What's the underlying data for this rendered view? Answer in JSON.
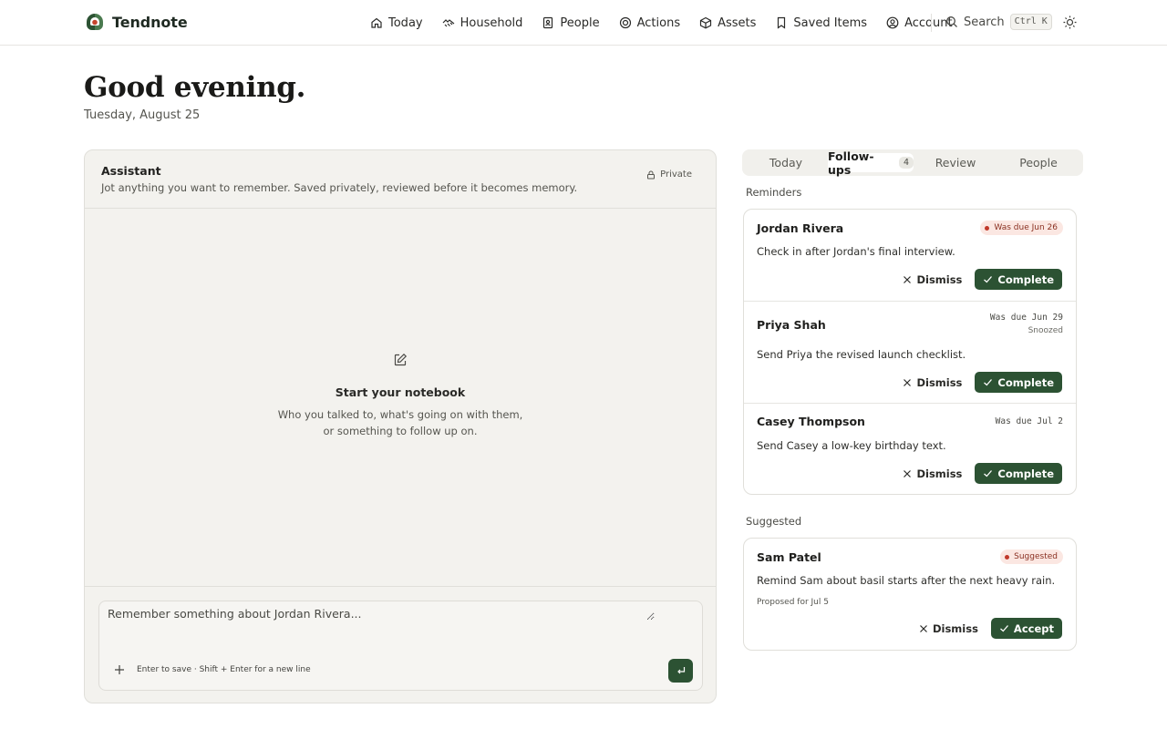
{
  "app": {
    "name": "Tendnote"
  },
  "nav": {
    "items": [
      {
        "label": "Today",
        "icon": "home-icon"
      },
      {
        "label": "Household",
        "icon": "household-icon"
      },
      {
        "label": "People",
        "icon": "contacts-book-icon"
      },
      {
        "label": "Actions",
        "icon": "target-icon"
      },
      {
        "label": "Assets",
        "icon": "box-icon"
      },
      {
        "label": "Saved Items",
        "icon": "bookmark-icon"
      },
      {
        "label": "Account",
        "icon": "user-circle-icon"
      }
    ],
    "search_label": "Search",
    "search_shortcut": "Ctrl K"
  },
  "greeting": {
    "title": "Good evening.",
    "date": "Tuesday, August 25"
  },
  "assistant": {
    "title": "Assistant",
    "subtitle": "Jot anything you want to remember. Saved privately, reviewed before it becomes memory.",
    "privacy": "Private",
    "empty_title": "Start your notebook",
    "empty_desc": "Who you talked to, what's going on with them, or something to follow up on.",
    "placeholder": "Remember something about Jordan Rivera...",
    "hint": "Enter to save · Shift + Enter for a new line"
  },
  "tabs": [
    {
      "label": "Today"
    },
    {
      "label": "Follow-ups",
      "count": "4"
    },
    {
      "label": "Review"
    },
    {
      "label": "People"
    }
  ],
  "reminders": {
    "label": "Reminders",
    "items": [
      {
        "name": "Jordan Rivera",
        "due": "Was due Jun 26",
        "overdue": true,
        "text": "Check in after Jordan's final interview."
      },
      {
        "name": "Priya Shah",
        "due": "Was due Jun 29",
        "status": "Snoozed",
        "text": "Send Priya the revised launch checklist."
      },
      {
        "name": "Casey Thompson",
        "due": "Was due Jul 2",
        "text": "Send Casey a low-key birthday text."
      }
    ],
    "dismiss_label": "Dismiss",
    "complete_label": "Complete"
  },
  "suggested": {
    "label": "Suggested",
    "item": {
      "name": "Sam Patel",
      "badge": "Suggested",
      "text": "Remind Sam about basil starts after the next heavy rain.",
      "proposed": "Proposed for Jul 5"
    },
    "dismiss_label": "Dismiss",
    "accept_label": "Accept"
  },
  "colors": {
    "accent": "#2c5233",
    "danger_bg": "#fbe7e2",
    "danger_dot": "#c0392b",
    "panel_bg": "#f3f2ee"
  }
}
